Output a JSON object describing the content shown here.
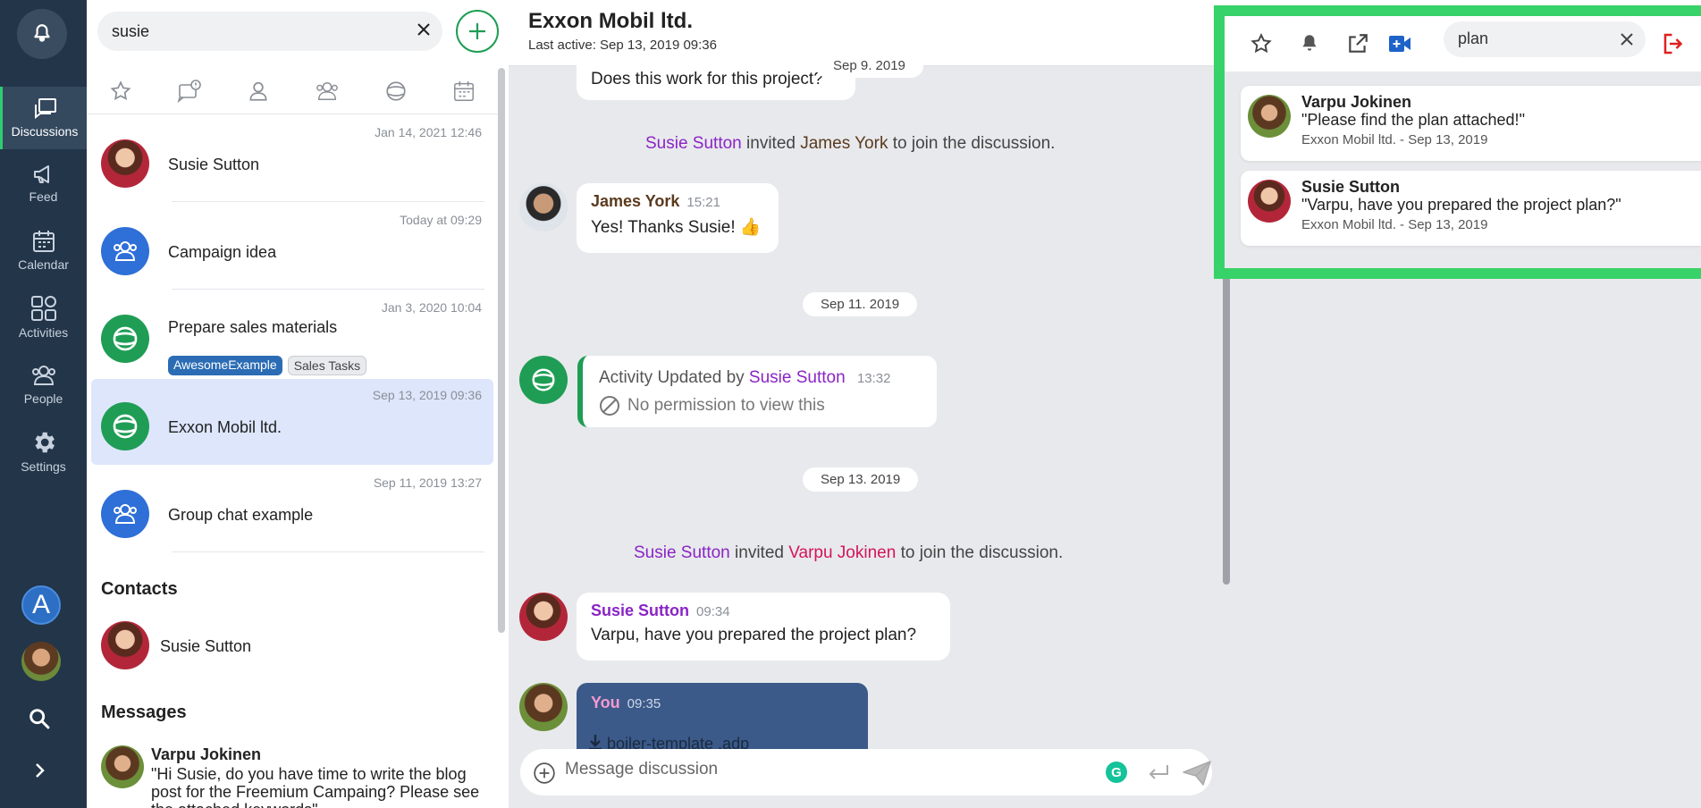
{
  "nav": {
    "items": [
      {
        "label": "Discussions",
        "icon": "discussions-icon"
      },
      {
        "label": "Feed",
        "icon": "megaphone-icon"
      },
      {
        "label": "Calendar",
        "icon": "calendar-icon"
      },
      {
        "label": "Activities",
        "icon": "activities-icon"
      },
      {
        "label": "People",
        "icon": "people-icon"
      },
      {
        "label": "Settings",
        "icon": "gear-icon"
      }
    ],
    "account_initial": "A"
  },
  "sidebar": {
    "search_value": "susie",
    "conversations": [
      {
        "time": "Jan 14, 2021 12:46",
        "name": "Susie Sutton"
      },
      {
        "time": "Today at 09:29",
        "name": "Campaign idea"
      },
      {
        "time": "Jan 3, 2020 10:04",
        "name": "Prepare sales materials",
        "tags": [
          "AwesomeExample",
          "Sales Tasks"
        ]
      },
      {
        "time": "Sep 13, 2019 09:36",
        "name": "Exxon Mobil ltd."
      },
      {
        "time": "Sep 11, 2019 13:27",
        "name": "Group chat example"
      }
    ],
    "contacts_title": "Contacts",
    "contact_name": "Susie Sutton",
    "messages_title": "Messages",
    "message_result": {
      "sender": "Varpu Jokinen",
      "text": "\"Hi Susie, do you have time to write the blog post for the Freemium Campaing? Please see the attached keywords\""
    }
  },
  "chat": {
    "title": "Exxon Mobil ltd.",
    "last_active": "Last active: Sep 13, 2019 09:36",
    "top_partial_text": "Does this work for this project?",
    "dates": [
      "Sep 9. 2019",
      "Sep 11. 2019",
      "Sep 13. 2019"
    ],
    "sys1": {
      "actor": "Susie Sutton",
      "verb": "invited",
      "target": "James York",
      "rest": "to join the discussion."
    },
    "james": {
      "name": "James York",
      "time": "15:21",
      "text": "Yes! Thanks Susie! 👍"
    },
    "activity": {
      "prefix": "Activity Updated by",
      "actor": "Susie Sutton",
      "time": "13:32",
      "note": "No permission to view this"
    },
    "sys2": {
      "actor": "Susie Sutton",
      "verb": "invited",
      "target": "Varpu Jokinen",
      "rest": "to join the discussion."
    },
    "susie": {
      "name": "Susie Sutton",
      "time": "09:34",
      "text": "Varpu, have you prepared the project plan?"
    },
    "you": {
      "name": "You",
      "time": "09:35",
      "file": "boiler-template .adp"
    },
    "composer_placeholder": "Message discussion"
  },
  "results": {
    "search_value": "plan",
    "items": [
      {
        "sender": "Varpu Jokinen",
        "quote": "\"Please find the plan attached!\"",
        "meta": "Exxon Mobil ltd. - Sep 13, 2019"
      },
      {
        "sender": "Susie Sutton",
        "quote": "\"Varpu, have you prepared the project plan?\"",
        "meta": "Exxon Mobil ltd. - Sep 13, 2019"
      }
    ],
    "highlight_color": "#37d26a"
  },
  "colors": {
    "rail": "#233549",
    "accent_green": "#1f9d55",
    "susie_purple": "#8a24c6",
    "varpu_pink": "#d4145a"
  }
}
